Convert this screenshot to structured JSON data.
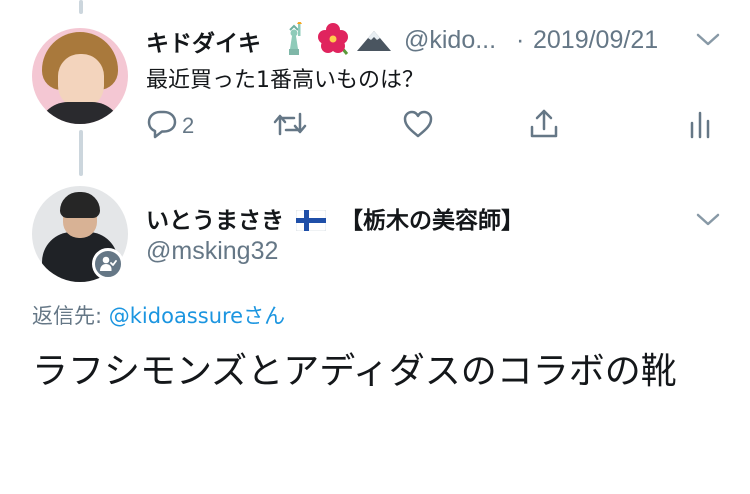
{
  "parent_tweet": {
    "author_name": "キドダイキ",
    "author_handle": "@kido...",
    "separator": "·",
    "date": "2019/09/21",
    "text": "最近買った1番高いものは？",
    "reply_count": "2",
    "name_emojis": [
      "statue-of-liberty-icon",
      "hibiscus-icon",
      "mountain-icon"
    ]
  },
  "reply_tweet": {
    "author_name": "いとうまさき",
    "author_name_suffix": "【栃木の美容師】",
    "author_handle": "@msking32",
    "replying_to_label": "返信先: ",
    "replying_to_handle": "@kidoassure",
    "replying_to_suffix": "さん",
    "text": "ラフシモンズとアディダスのコラボの靴",
    "flag_icon": "finland-flag-icon"
  },
  "colors": {
    "text_primary": "#14171a",
    "text_secondary": "#657786",
    "link": "#1b95e0",
    "thread_line": "#ccd6dd"
  }
}
